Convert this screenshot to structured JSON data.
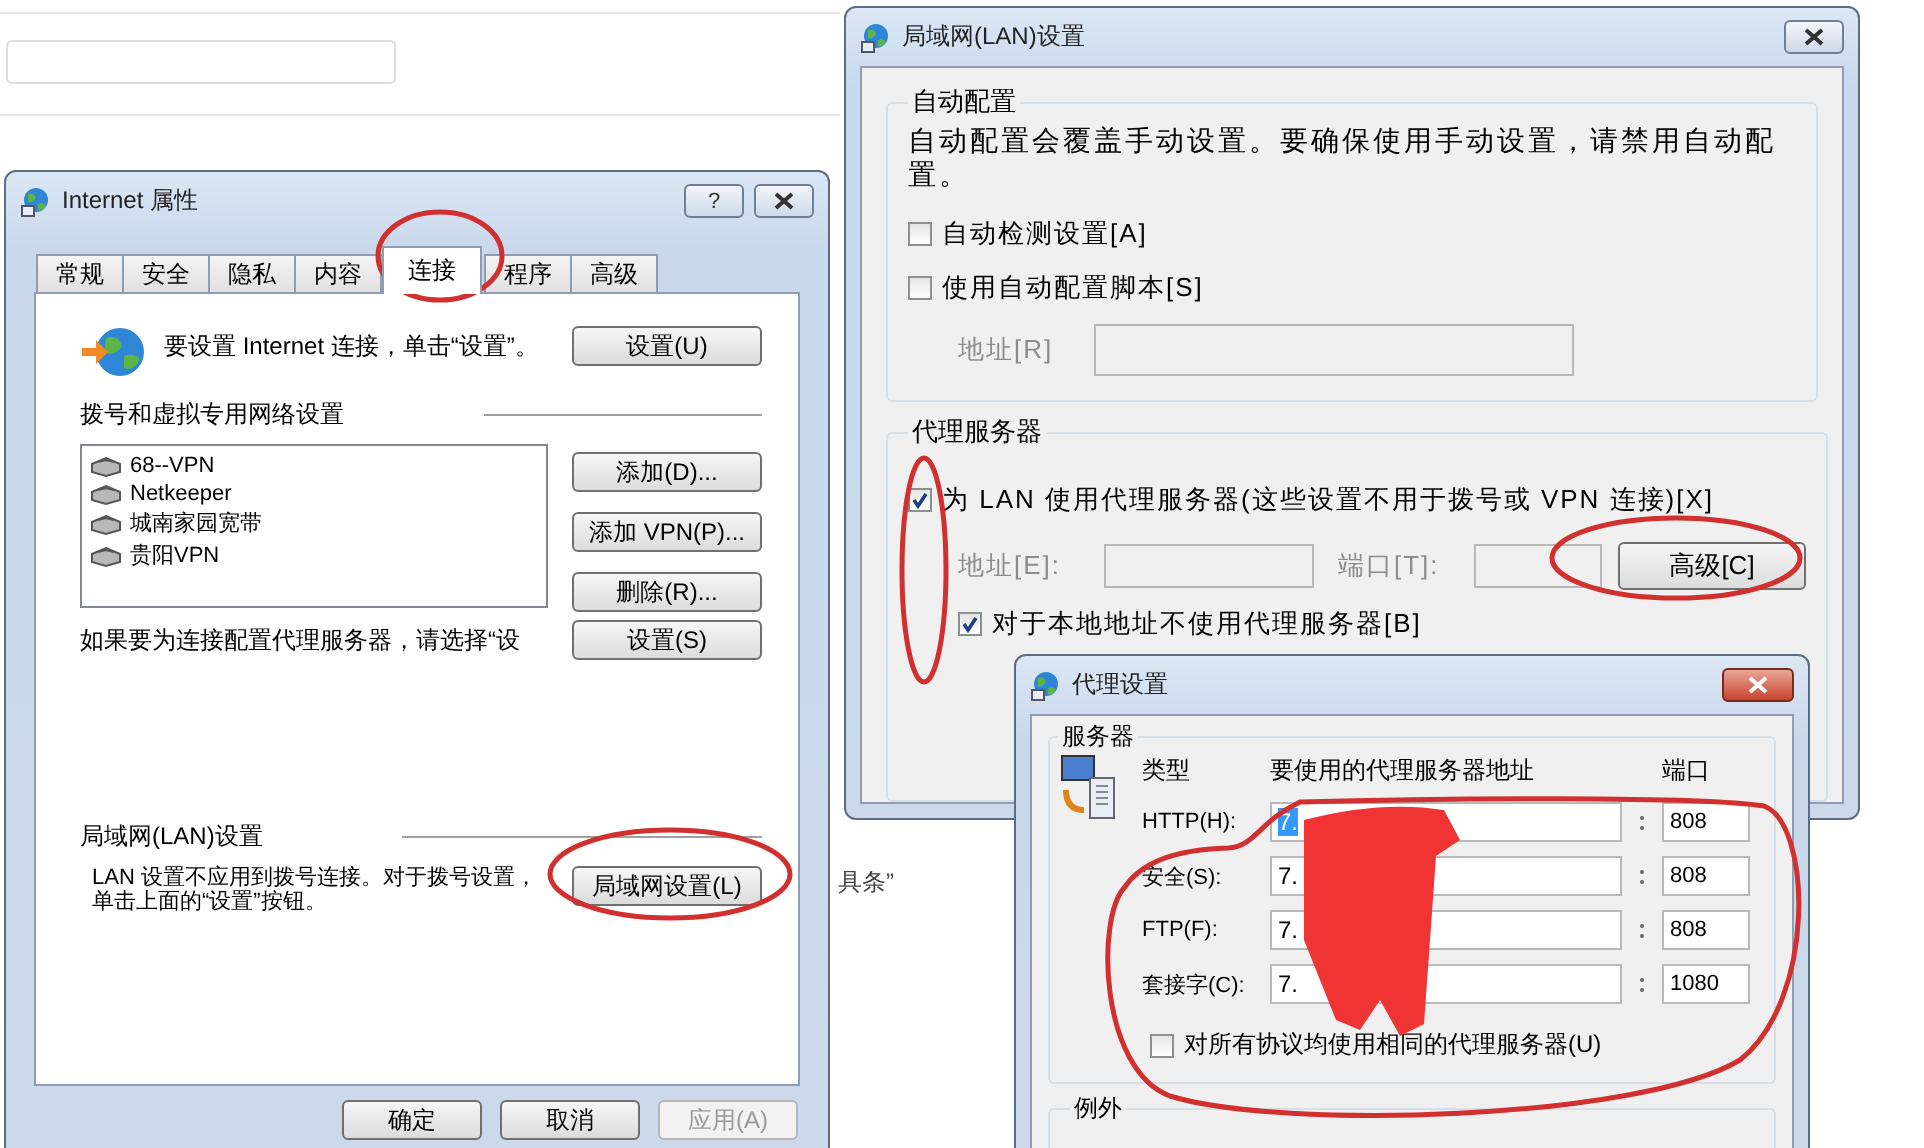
{
  "background": {
    "text": "具条”"
  },
  "internet_properties": {
    "title": "Internet 属性",
    "help_button": "?",
    "tabs": [
      {
        "label": "常规",
        "selected": false
      },
      {
        "label": "安全",
        "selected": false
      },
      {
        "label": "隐私",
        "selected": false
      },
      {
        "label": "内容",
        "selected": false
      },
      {
        "label": "连接",
        "selected": true
      },
      {
        "label": "程序",
        "selected": false
      },
      {
        "label": "高级",
        "selected": false
      }
    ],
    "setup": {
      "text": "要设置 Internet 连接，单击“设置”。",
      "button": "设置(U)"
    },
    "dialup": {
      "heading": "拨号和虚拟专用网络设置",
      "connections": [
        {
          "name": "68--VPN"
        },
        {
          "name": "Netkeeper"
        },
        {
          "name": "城南家园宽带"
        },
        {
          "name": "贵阳VPN"
        }
      ],
      "buttons": [
        "添加(D)...",
        "添加 VPN(P)...",
        "删除(R)..."
      ],
      "proxy_text": "如果要为连接配置代理服务器，请选择“设",
      "proxy_button": "设置(S)"
    },
    "lan": {
      "heading": "局域网(LAN)设置",
      "text": "LAN 设置不应用到拨号连接。对于拨号设置，单击上面的“设置”按钮。",
      "button": "局域网设置(L)"
    },
    "footer_buttons": [
      {
        "label": "确定",
        "disabled": false
      },
      {
        "label": "取消",
        "disabled": false
      },
      {
        "label": "应用(A)",
        "disabled": true
      }
    ]
  },
  "lan_window": {
    "title": "局域网(LAN)设置",
    "auto_config": {
      "heading": "自动配置",
      "description": "自动配置会覆盖手动设置。要确保使用手动设置，请禁用自动配置。",
      "options": [
        {
          "label": "自动检测设置[A]",
          "checked": false
        },
        {
          "label": "使用自动配置脚本[S]",
          "checked": false
        }
      ],
      "address_label": "地址[R]"
    },
    "proxy": {
      "heading": "代理服务器",
      "use_proxy": {
        "label": "为 LAN 使用代理服务器(这些设置不用于拨号或 VPN 连接)[X]",
        "checked": true
      },
      "address_label": "地址[E]:",
      "port_label": "端口[T]:",
      "advanced_button": "高级[C]",
      "bypass_local": {
        "label": "对于本地地址不使用代理服务器[B]",
        "checked": true
      }
    }
  },
  "proxy_window": {
    "title": "代理设置",
    "servers": {
      "heading": "服务器",
      "columns": [
        "类型",
        "要使用的代理服务器地址",
        "端口"
      ],
      "rows": [
        {
          "type": "HTTP(H):",
          "address": "7.",
          "port": "808",
          "text_selected": true
        },
        {
          "type": "安全(S):",
          "address": "7.",
          "port": "808",
          "text_selected": false
        },
        {
          "type": "FTP(F):",
          "address": "7.",
          "port": "808",
          "text_selected": false
        },
        {
          "type": "套接字(C):",
          "address": "7.",
          "port": "1080",
          "text_selected": false
        }
      ],
      "same_for_all": {
        "label": "对所有协议均使用相同的代理服务器(U)",
        "checked": false
      }
    },
    "exceptions": {
      "heading": "例外"
    }
  }
}
